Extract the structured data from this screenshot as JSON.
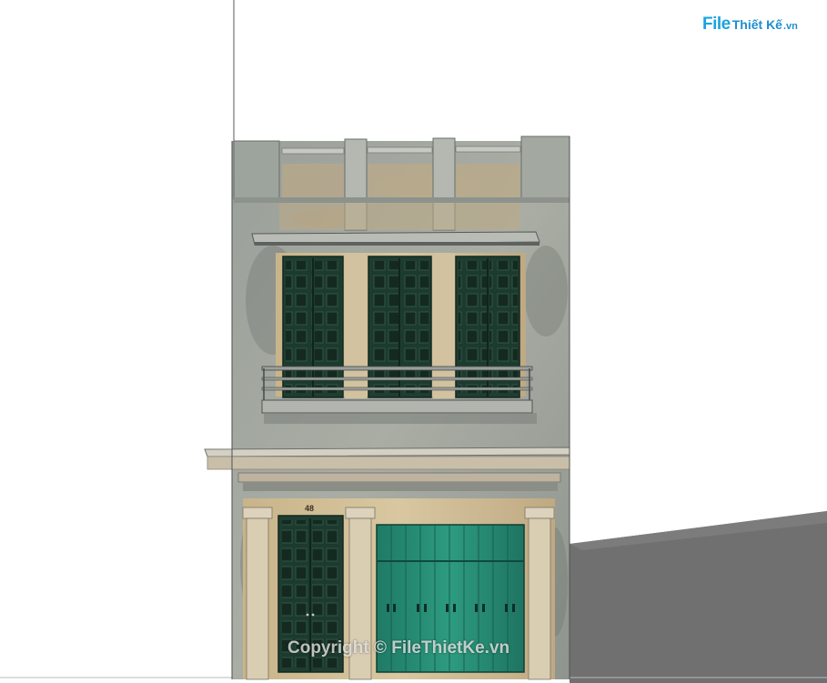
{
  "logo": {
    "file": "File",
    "rest": "Thiết Kế",
    "vn": ".vn"
  },
  "house_number": "48",
  "watermark": "Copyright © FileThietKe.vn"
}
